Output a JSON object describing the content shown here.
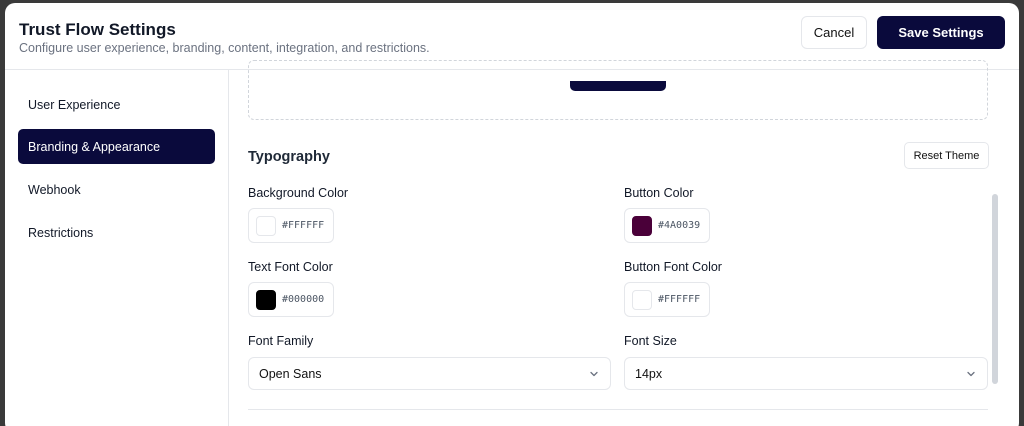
{
  "header": {
    "title": "Trust Flow Settings",
    "subtitle": "Configure user experience, branding, content, integration, and restrictions.",
    "cancel_label": "Cancel",
    "save_label": "Save Settings"
  },
  "sidebar": {
    "items": [
      {
        "label": "User Experience",
        "active": false
      },
      {
        "label": "Branding & Appearance",
        "active": true
      },
      {
        "label": "Webhook",
        "active": false
      },
      {
        "label": "Restrictions",
        "active": false
      }
    ]
  },
  "typography": {
    "title": "Typography",
    "reset_label": "Reset Theme",
    "background_color": {
      "label": "Background Color",
      "value": "#FFFFFF"
    },
    "button_color": {
      "label": "Button Color",
      "value": "#4A0039"
    },
    "text_font_color": {
      "label": "Text Font Color",
      "value": "#000000"
    },
    "button_font_color": {
      "label": "Button Font Color",
      "value": "#FFFFFF"
    },
    "font_family": {
      "label": "Font Family",
      "value": "Open Sans"
    },
    "font_size": {
      "label": "Font Size",
      "value": "14px"
    }
  },
  "colors": {
    "accent": "#0a0a3c"
  },
  "icons": {
    "select_chevron": "chevron-down-icon"
  }
}
